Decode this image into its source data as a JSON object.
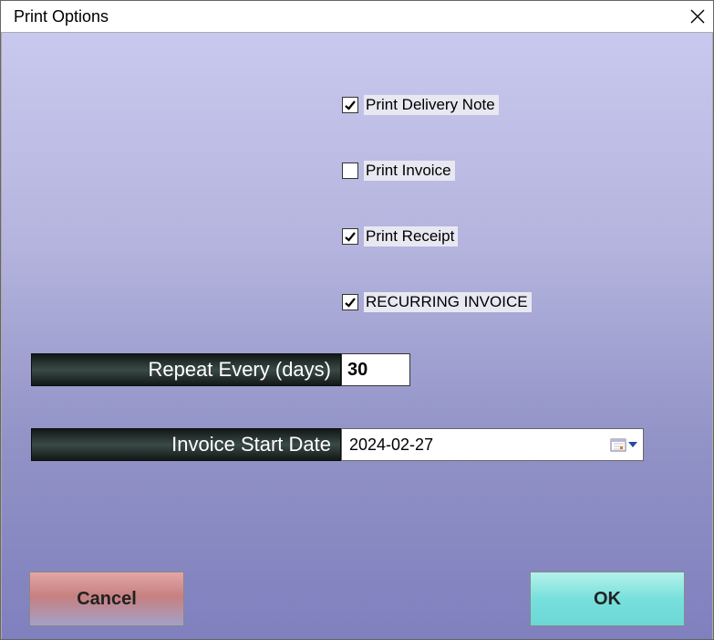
{
  "window": {
    "title": "Print Options"
  },
  "checkboxes": {
    "delivery_note": {
      "label": "Print Delivery Note",
      "checked": true
    },
    "invoice": {
      "label": "Print Invoice",
      "checked": false
    },
    "receipt": {
      "label": "Print Receipt",
      "checked": true
    },
    "recurring": {
      "label": "RECURRING INVOICE",
      "checked": true
    }
  },
  "fields": {
    "repeat_every": {
      "label": "Repeat Every (days)",
      "value": "30"
    },
    "start_date": {
      "label": "Invoice Start Date",
      "value": "2024-02-27"
    }
  },
  "buttons": {
    "cancel": "Cancel",
    "ok": "OK"
  }
}
